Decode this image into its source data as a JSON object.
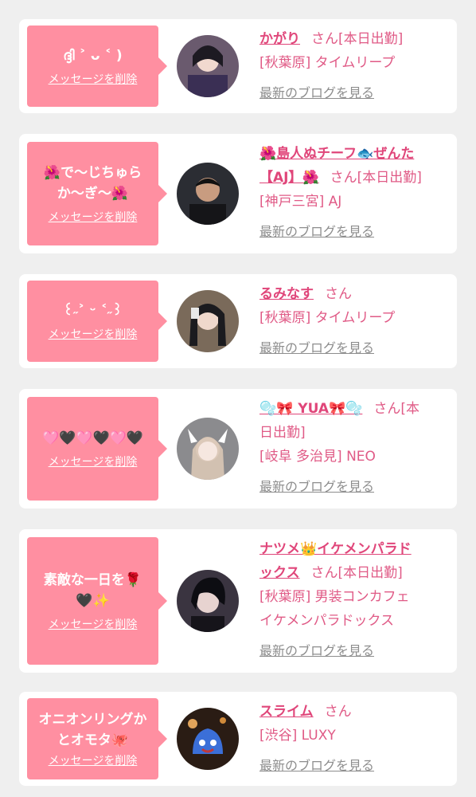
{
  "delete_label": "メッセージを削除",
  "blog_label": "最新のブログを見る",
  "san_label": "さん",
  "cards": [
    {
      "message": "ദ്ദി ˃ ᴗ ˂ )",
      "name": "かがり",
      "status": "[本日出勤]",
      "location": "[秋葉原] タイムリープ"
    },
    {
      "message_line1": "🌺で〜じちゅら",
      "message_line2": "か〜ぎ〜🌺",
      "name_line1": "🌺島人ぬチーフ🐟ぜんた",
      "name_line2": "【AJ】🌺",
      "status": "[本日出勤]",
      "location": "[神戸三宮] AJ"
    },
    {
      "message": "꒰˶˃ ᵕ ˂˶꒱",
      "name": "るみなす",
      "status": "",
      "location": "[秋葉原] タイムリープ"
    },
    {
      "message": "🩷🖤🩷🖤🩷🖤",
      "name": "🫧🎀 YUA🎀🫧",
      "status_line1": "[本",
      "status_line2": "日出勤]",
      "location": "[岐阜 多治見] NEO"
    },
    {
      "message_line1": "素敵な一日を🌹",
      "message_line2": "🖤✨",
      "name_line1": "ナツメ👑イケメンパラド",
      "name_line2": "ックス",
      "status": "[本日出勤]",
      "location_line1": "[秋葉原] 男装コンカフェ",
      "location_line2": "イケメンパラドックス"
    },
    {
      "message_line1": "オニオンリングか",
      "message_line2": "とオモタ🐙",
      "name": "スライム",
      "status": "",
      "location": "[渋谷] LUXY"
    }
  ],
  "colors": {
    "accent": "#ff8fa1",
    "name": "#e0467a",
    "text": "#e05a86",
    "muted": "#8d8d8d",
    "bg": "#efefef"
  }
}
